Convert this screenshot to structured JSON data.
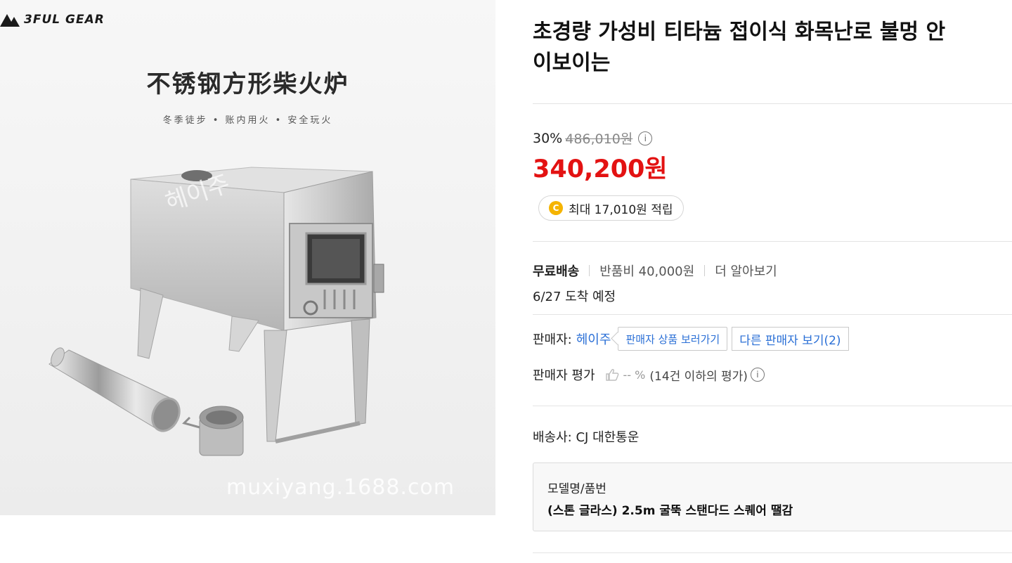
{
  "image": {
    "brand": "3FUL GEAR",
    "hero_title": "不锈钢方形柴火炉",
    "hero_subtitle": "冬季徒步 • 账内用火 • 安全玩火",
    "stove_watermark": "헤이주",
    "watermark": "muxiyang.1688.com"
  },
  "product": {
    "title_line1": "초경량 가성비 티타늄 접이식 화목난로 불멍 안",
    "title_line2": "이보이는"
  },
  "price": {
    "discount_rate": "30%",
    "original_price": "486,010원",
    "sale_price": "340,200원",
    "info_icon": "i"
  },
  "points": {
    "coin_icon": "C",
    "text": "최대 17,010원 적립"
  },
  "shipping": {
    "label": "무료배송",
    "return_fee": "반품비 40,000원",
    "more": "더 알아보기",
    "arrival": "6/27 도착 예정"
  },
  "seller": {
    "label": "판매자:",
    "name": "헤이주",
    "products_button": "판매자 상품 보러가기",
    "other_sellers_button": "다른 판매자 보기(2)",
    "rating_label": "판매자 평가",
    "rating_value": "-- %",
    "rating_note": "(14건 이하의 평가)",
    "info_icon": "i"
  },
  "carrier": {
    "text": "배송사: CJ 대한통운"
  },
  "model": {
    "label": "모델명/품번",
    "value": "(스톤 글라스) 2.5m 굴뚝 스탠다드 스퀘어 땔감"
  },
  "colors": {
    "sale_red": "#e31212",
    "link_blue": "#2a6fd6",
    "coin_yellow": "#f5b400"
  }
}
